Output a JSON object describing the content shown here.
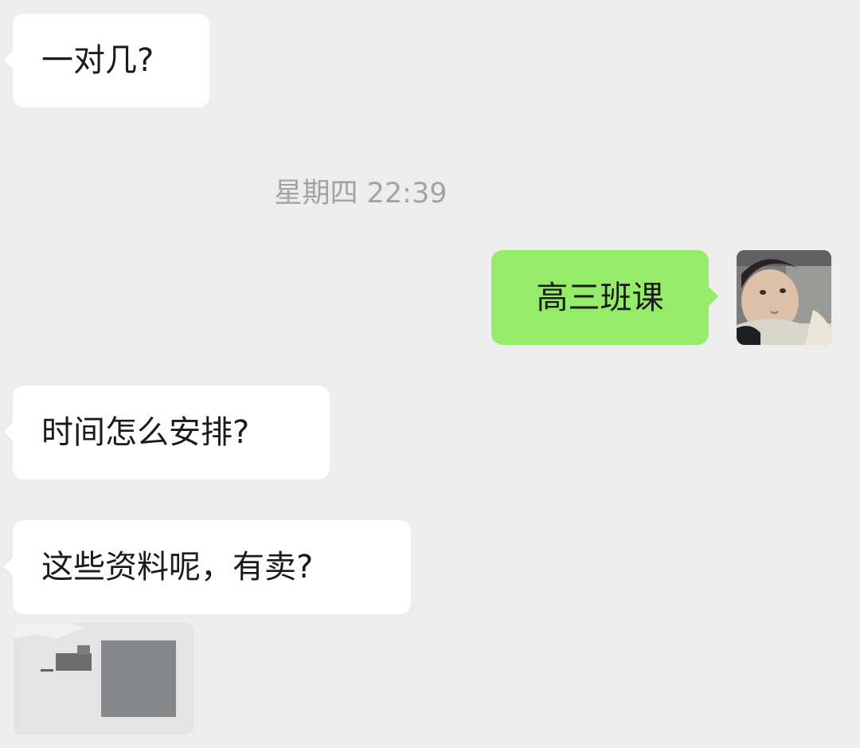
{
  "chat": {
    "messages": [
      {
        "side": "incoming",
        "text": "一对几?"
      },
      {
        "side": "outgoing",
        "text": "高三班课"
      },
      {
        "side": "incoming",
        "text": "时间怎么安排?"
      },
      {
        "side": "incoming",
        "text": "这些资料呢，有卖?"
      }
    ],
    "timestamp": "星期四 22:39",
    "avatar_icon": "child-photo-avatar",
    "image_attachment_icon": "blurred-document-image-icon"
  },
  "colors": {
    "background": "#ededed",
    "incoming_bubble": "#ffffff",
    "outgoing_bubble": "#95ec69",
    "timestamp_text": "#a3a3a3"
  }
}
